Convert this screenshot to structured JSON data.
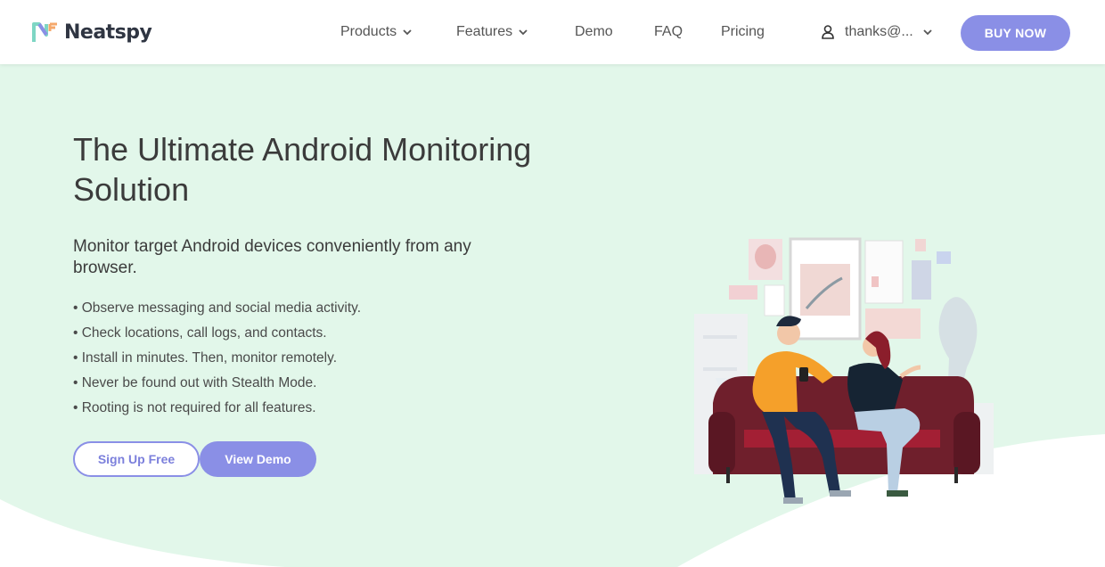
{
  "header": {
    "brand": "Neatspy",
    "nav": [
      {
        "label": "Products",
        "dropdown": true
      },
      {
        "label": "Features",
        "dropdown": true
      },
      {
        "label": "Demo",
        "dropdown": false
      },
      {
        "label": "FAQ",
        "dropdown": false
      },
      {
        "label": "Pricing",
        "dropdown": false
      }
    ],
    "user": {
      "label": "thanks@...",
      "icon": "user-icon"
    },
    "buy_label": "BUY NOW"
  },
  "hero": {
    "title": "The Ultimate Android Monitoring Solution",
    "subtitle": "Monitor target Android devices conveniently from any browser.",
    "bullets": [
      "• Observe messaging and social media activity.",
      "• Check locations, call logs, and contacts.",
      "• Install in minutes. Then, monitor remotely.",
      "• Never be found out with Stealth Mode.",
      "• Rooting is not required for all features."
    ],
    "signup_label": "Sign Up Free",
    "demo_label": "View Demo"
  },
  "colors": {
    "accent": "#8a8fe6",
    "hero_bg": "#e2f7ea",
    "text": "#3b3b3b"
  }
}
